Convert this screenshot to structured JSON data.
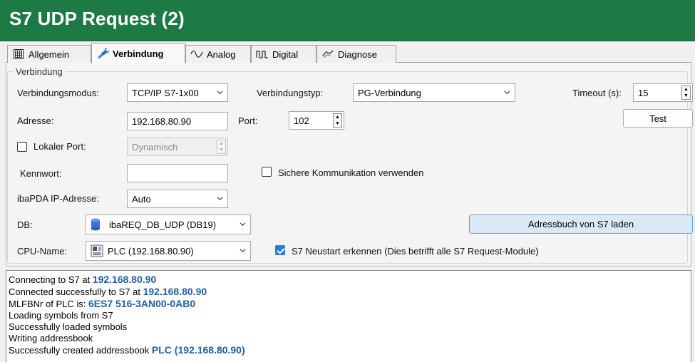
{
  "window": {
    "title": "S7 UDP Request (2)"
  },
  "tabs": [
    {
      "label": "Allgemein",
      "icon": "general-grid-icon"
    },
    {
      "label": "Verbindung",
      "icon": "connection-plug-icon",
      "active": true
    },
    {
      "label": "Analog",
      "icon": "analog-wave-icon"
    },
    {
      "label": "Digital",
      "icon": "digital-pulse-icon"
    },
    {
      "label": "Diagnose",
      "icon": "diagnose-icon"
    }
  ],
  "connection": {
    "group_label": "Verbindung",
    "mode_label": "Verbindungsmodus:",
    "mode_value": "TCP/IP S7-1x00",
    "type_label": "Verbindungstyp:",
    "type_value": "PG-Verbindung",
    "timeout_label": "Timeout (s):",
    "timeout_value": "15",
    "test_button": "Test",
    "address_label": "Adresse:",
    "address_value": "192.168.80.90",
    "port_label": "Port:",
    "port_value": "102",
    "local_port_label": "Lokaler Port:",
    "local_port_checked": false,
    "local_port_value": "Dynamisch",
    "password_label": "Kennwort:",
    "password_value": "",
    "secure_label": "Sichere Kommunikation verwenden",
    "secure_checked": false,
    "ibapda_ip_label": "ibaPDA IP-Adresse:",
    "ibapda_ip_value": "Auto",
    "db_label": "DB:",
    "db_value": "ibaREQ_DB_UDP (DB19)",
    "addressbook_button": "Adressbuch von S7 laden",
    "cpu_label": "CPU-Name:",
    "cpu_value": "PLC (192.168.80.90)",
    "restart_label": "S7 Neustart erkennen (Dies betrifft alle S7 Request-Module)",
    "restart_checked": true
  },
  "log": [
    {
      "text": "Connecting to S7 at ",
      "value": "192.168.80.90"
    },
    {
      "text": "Connected successfully to S7 at ",
      "value": "192.168.80.90"
    },
    {
      "text": "MLFBNr of PLC is:  ",
      "value": "6ES7 516-3AN00-0AB0"
    },
    {
      "text": "Loading symbols from S7",
      "value": ""
    },
    {
      "text": "Successfully loaded symbols",
      "value": ""
    },
    {
      "text": "Writing addressbook",
      "value": ""
    },
    {
      "text": "Successfully created addressbook ",
      "value": "PLC (192.168.80.90)"
    }
  ],
  "colors": {
    "title_bar": "#1e7a44",
    "log_value": "#1f5ea8",
    "checkbox_checked": "#2f7bd8"
  }
}
